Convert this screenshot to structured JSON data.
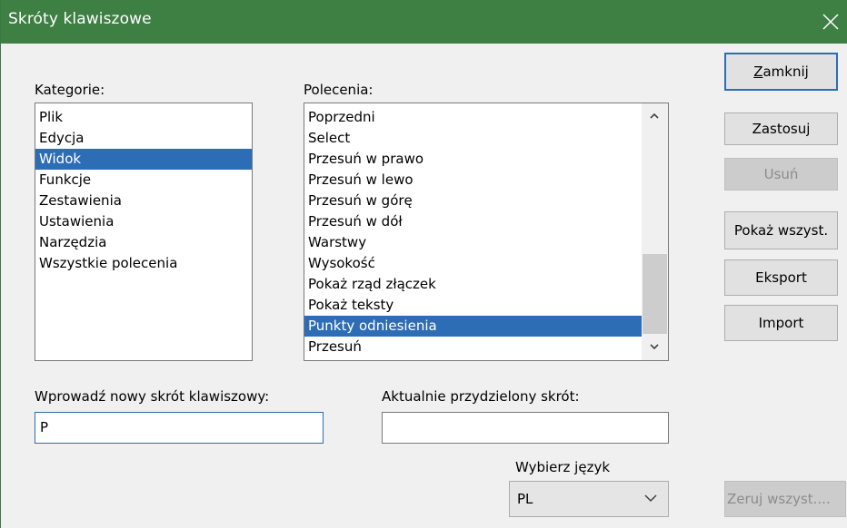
{
  "window": {
    "title": "Skróty klawiszowe",
    "close_icon": "close-icon"
  },
  "categories": {
    "label": "Kategorie:",
    "items": [
      "Plik",
      "Edycja",
      "Widok",
      "Funkcje",
      "Zestawienia",
      "Ustawienia",
      "Narzędzia",
      "Wszystkie polecenia"
    ],
    "selected": "Widok"
  },
  "commands": {
    "label": "Polecenia:",
    "items": [
      "Poprzedni",
      "Select",
      "Przesuń w prawo",
      "Przesuń w lewo",
      "Przesuń w górę",
      "Przesuń w dół",
      "Warstwy",
      "Wysokość",
      "Pokaż rząd złączek",
      "Pokaż teksty",
      "Punkty odniesienia",
      "Przesuń"
    ],
    "selected": "Punkty odniesienia"
  },
  "buttons": {
    "close": {
      "label": "Zamknij",
      "mnemonic": "Z",
      "rest": "amknij"
    },
    "apply": {
      "label": "Zastosuj"
    },
    "delete": {
      "label": "Usuń",
      "disabled": true
    },
    "show_all": {
      "label": "Pokaż wszyst."
    },
    "export": {
      "label": "Eksport"
    },
    "import": {
      "label": "Import"
    },
    "reset_all": {
      "label": "Zeruj wszyst....",
      "disabled": true
    }
  },
  "new_shortcut": {
    "label": "Wprowadź nowy skrót klawiszowy:",
    "value": "P"
  },
  "current_shortcut": {
    "label": "Aktualnie przydzielony skrót:",
    "value": ""
  },
  "language": {
    "label": "Wybierz język",
    "value": "PL"
  },
  "colors": {
    "titlebar": "#3e7f44",
    "selection": "#2d6db5"
  }
}
